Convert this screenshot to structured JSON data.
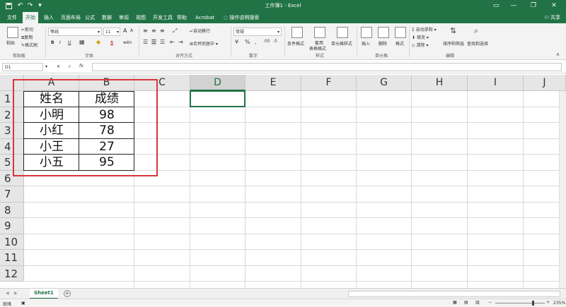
{
  "titlebar": {
    "title": "工作簿1 - Excel",
    "save_icon": "floppy-icon",
    "undo_glyph": "↶",
    "redo_glyph": "↷",
    "customize_glyph": "▾",
    "minimize_glyph": "—",
    "restore_glyph": "❐",
    "close_glyph": "✕",
    "ribbon_options_glyph": "▭"
  },
  "tabs": [
    {
      "label": "文件"
    },
    {
      "label": "开始"
    },
    {
      "label": "插入"
    },
    {
      "label": "页面布局"
    },
    {
      "label": "公式"
    },
    {
      "label": "数据"
    },
    {
      "label": "审阅"
    },
    {
      "label": "视图"
    },
    {
      "label": "开发工具"
    },
    {
      "label": "帮助"
    },
    {
      "label": "Acrobat"
    }
  ],
  "tell_me": "操作说明搜索",
  "share": "共享",
  "ribbon": {
    "clipboard": {
      "paste": "粘贴",
      "cut": "剪切",
      "copy": "复制",
      "format_painter": "格式刷",
      "label": "剪贴板"
    },
    "font": {
      "name": "等线",
      "size": "11",
      "bold": "B",
      "italic": "I",
      "underline": "U",
      "grow": "A",
      "shrink": "A",
      "color_a": "A",
      "phonetic": "wén",
      "label": "字体"
    },
    "alignment": {
      "wrap": "自动换行",
      "merge": "合并后居中",
      "label": "对齐方式"
    },
    "number": {
      "format": "常规",
      "label": "数字"
    },
    "styles": {
      "conditional": "条件格式",
      "table_line1": "套用",
      "table_line2": "表格格式",
      "cell_styles": "单元格样式",
      "label": "样式"
    },
    "cells": {
      "insert": "插入",
      "delete": "删除",
      "format": "格式",
      "label": "单元格"
    },
    "editing": {
      "autosum": "自动求和",
      "fill": "填充",
      "clear": "清除",
      "sort": "排序和筛选",
      "find": "查找和选择",
      "label": "编辑"
    }
  },
  "formula_bar": {
    "name_box": "D1",
    "fx": "fx",
    "cancel": "✕",
    "enter": "✓"
  },
  "columns": [
    "A",
    "B",
    "C",
    "D",
    "E",
    "F",
    "G",
    "H",
    "I",
    "J"
  ],
  "selected_column": "D",
  "rows": [
    "1",
    "2",
    "3",
    "4",
    "5",
    "6",
    "7",
    "8",
    "9",
    "10",
    "11",
    "12"
  ],
  "table": {
    "headers": [
      "姓名",
      "成绩"
    ],
    "rows": [
      [
        "小明",
        "98"
      ],
      [
        "小红",
        "78"
      ],
      [
        "小王",
        "27"
      ],
      [
        "小五",
        "95"
      ]
    ]
  },
  "sheet_tabs": [
    {
      "label": "Sheet1"
    }
  ],
  "add_sheet": "+",
  "status": {
    "ready": "就绪",
    "zoom": "235%",
    "zoom_minus": "−",
    "zoom_plus": "+"
  },
  "colors": {
    "brand": "#217346",
    "highlight_box": "#d9363e"
  }
}
